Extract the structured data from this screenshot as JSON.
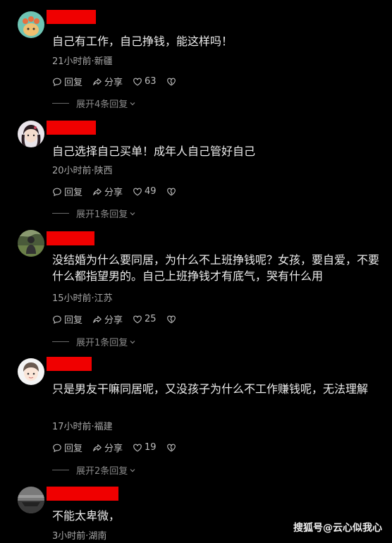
{
  "comments": [
    {
      "text": "自己有工作，自己挣钱，能这样吗！",
      "meta": "21小时前·新疆",
      "reply_label": "回复",
      "share_label": "分享",
      "likes": "63",
      "expand_label": "展开4条回复"
    },
    {
      "text": "自己选择自己买单！成年人自己管好自己",
      "meta": "20小时前·陕西",
      "reply_label": "回复",
      "share_label": "分享",
      "likes": "49",
      "expand_label": "展开1条回复"
    },
    {
      "text": "没结婚为什么要同居，为什么不上班挣钱呢？女孩，要自爱，不要什么都指望男的。自己上班挣钱才有底气，哭有什么用",
      "meta": "15小时前·江苏",
      "reply_label": "回复",
      "share_label": "分享",
      "likes": "25",
      "expand_label": "展开1条回复"
    },
    {
      "text": "只是男友干嘛同居呢，又没孩子为什么不工作赚钱呢，无法理解",
      "meta": "17小时前·福建",
      "reply_label": "回复",
      "share_label": "分享",
      "likes": "19",
      "expand_label": "展开2条回复"
    },
    {
      "text": "不能太卑微，",
      "meta": "3小时前·湖南"
    }
  ],
  "watermark": "搜狐号@云心似我心",
  "colors": {
    "background": "#000000",
    "redaction": "#f00000"
  }
}
